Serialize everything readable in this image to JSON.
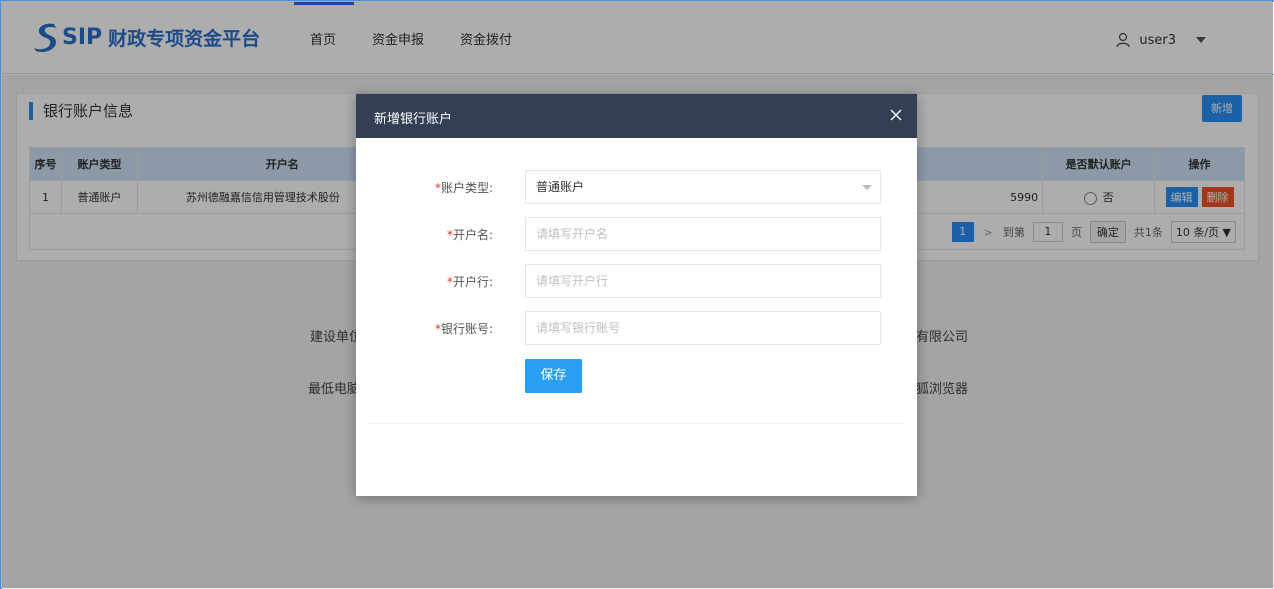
{
  "app": {
    "logo_sip": "SIP",
    "logo_name": "财政专项资金平台",
    "nav": [
      {
        "label": "首页"
      },
      {
        "label": "资金申报"
      },
      {
        "label": "资金拨付"
      }
    ],
    "user": "user3"
  },
  "panel": {
    "title": "银行账户信息",
    "new_button": "新增",
    "columns": [
      "序号",
      "账户类型",
      "开户名",
      "是否默认账户",
      "操作"
    ],
    "rows": [
      {
        "index": "1",
        "type": "普通账户",
        "name": "苏州德融嘉信信用管理技术股份",
        "account_tail": "5990",
        "default": "否",
        "edit": "编辑",
        "delete": "删除"
      }
    ],
    "pager": {
      "current": "1",
      "next": ">",
      "goto_label": "到第",
      "goto_value": "1",
      "page_unit": "页",
      "confirm": "确定",
      "total": "共1条",
      "page_size": "10 条/页 ▼"
    }
  },
  "footer": {
    "line1_left": "建设单位",
    "line1_right": "有限公司",
    "line2_left": "最低电脑",
    "line2_right": "狐浏览器"
  },
  "modal": {
    "title": "新增银行账户",
    "fields": [
      {
        "label": "账户类型:",
        "value": "普通账户",
        "placeholder": ""
      },
      {
        "label": "开户名:",
        "value": "",
        "placeholder": "请填写开户名"
      },
      {
        "label": "开户行:",
        "value": "",
        "placeholder": "请填写开户行"
      },
      {
        "label": "银行账号:",
        "value": "",
        "placeholder": "请填写银行账号"
      }
    ],
    "required_mark": "*",
    "save_button": "保存"
  },
  "colors": {
    "brand": "#2a6fc9",
    "primary": "#2a8ff7",
    "danger": "#f0522a",
    "modal_header": "#333f55"
  }
}
